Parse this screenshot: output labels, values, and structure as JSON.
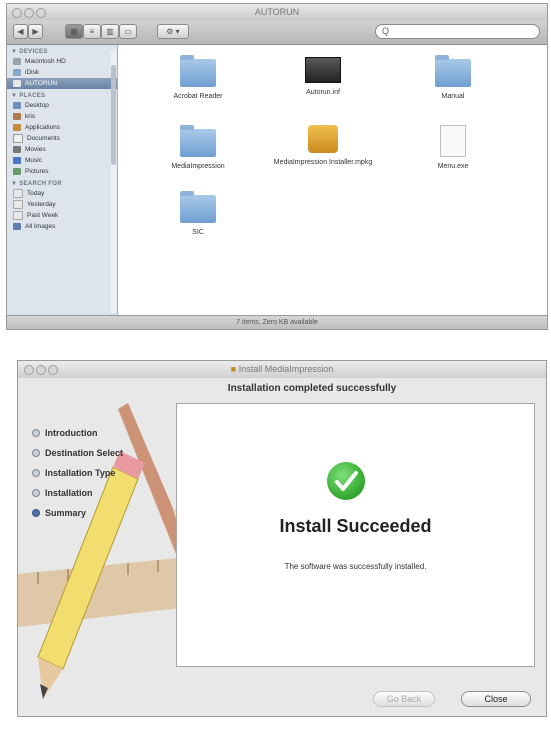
{
  "finder": {
    "title": "AUTORUN",
    "search_placeholder": "Q",
    "sidebar": {
      "devices_header": "▼ DEVICES",
      "devices": [
        "Macintosh HD",
        "iDisk",
        "AUTORUN"
      ],
      "places_header": "▼ PLACES",
      "places": [
        "Desktop",
        "kris",
        "Applications",
        "Documents",
        "Movies",
        "Music",
        "Pictures"
      ],
      "search_header": "▼ SEARCH FOR",
      "search_for": [
        "Today",
        "Yesterday",
        "Past Week",
        "All Images"
      ]
    },
    "files": [
      {
        "name": "Acrobat Reader",
        "icon": "folder-icon"
      },
      {
        "name": "Autorun.inf",
        "icon": "app-icon"
      },
      {
        "name": "Manual",
        "icon": "folder-icon"
      },
      {
        "name": "MediaImpression",
        "icon": "folder-icon"
      },
      {
        "name": "MediaImpression Installer.mpkg",
        "icon": "package-icon"
      },
      {
        "name": "Menu.exe",
        "icon": "document-icon"
      },
      {
        "name": "SIC",
        "icon": "folder-icon"
      }
    ],
    "status": "7 items, Zero KB available"
  },
  "installer": {
    "title": "Install MediaImpression",
    "heading": "Installation completed successfully",
    "steps": [
      "Introduction",
      "Destination Select",
      "Installation Type",
      "Installation",
      "Summary"
    ],
    "current_step": "Summary",
    "result_title": "Install Succeeded",
    "result_message": "The software was successfully installed.",
    "go_back_label": "Go Back",
    "close_label": "Close"
  }
}
